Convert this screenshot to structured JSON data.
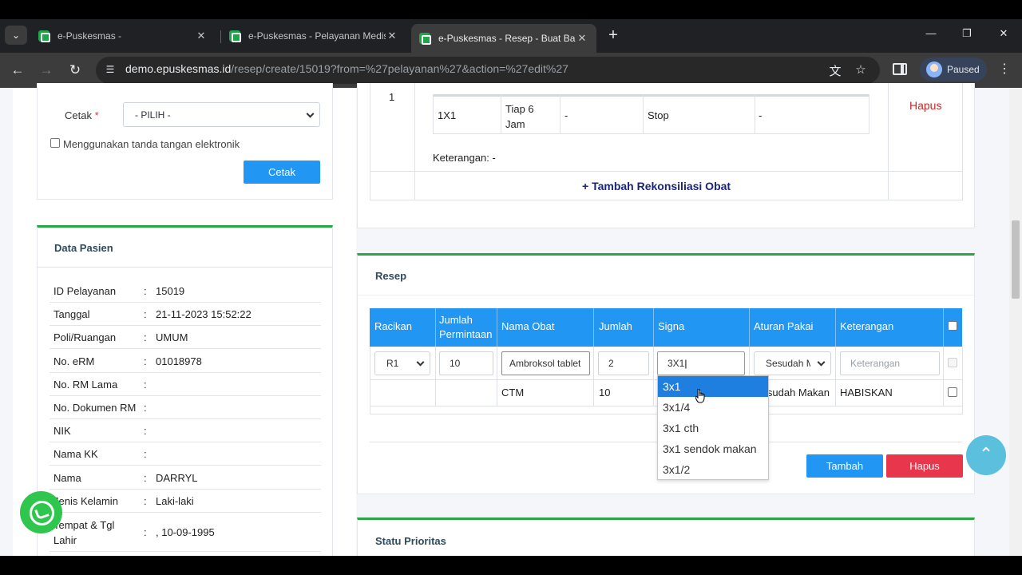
{
  "browser": {
    "tabs": [
      {
        "title": "e-Puskesmas -"
      },
      {
        "title": "e-Puskesmas - Pelayanan Medis"
      },
      {
        "title": "e-Puskesmas - Resep - Buat Baru"
      }
    ],
    "url_host": "demo.epuskesmas.id",
    "url_path": "/resep/create/15019?from=%27pelayanan%27&action=%27edit%27",
    "profile_label": "Paused"
  },
  "print_card": {
    "cetak_label": "Cetak",
    "required_mark": "*",
    "select_value": "- PILIH -",
    "esign_label": "Menggunakan tanda tangan elektronik",
    "cetak_button": "Cetak"
  },
  "patient": {
    "title": "Data Pasien",
    "rows": [
      {
        "key": "ID Pelayanan",
        "value": "15019"
      },
      {
        "key": "Tanggal",
        "value": "21-11-2023 15:52:22"
      },
      {
        "key": "Poli/Ruangan",
        "value": "UMUM"
      },
      {
        "key": "No. eRM",
        "value": "01018978"
      },
      {
        "key": "No. RM Lama",
        "value": ""
      },
      {
        "key": "No. Dokumen RM",
        "value": ""
      },
      {
        "key": "NIK",
        "value": ""
      },
      {
        "key": "Nama KK",
        "value": ""
      },
      {
        "key": "Nama",
        "value": "DARRYL"
      },
      {
        "key": "Jenis Kelamin",
        "value": "Laki-laki"
      },
      {
        "key": "Tempat & Tgl Lahir",
        "value": ", 10-09-1995"
      }
    ]
  },
  "reconciliation": {
    "row_no": "1",
    "cells": [
      "1X1",
      "Tiap 6 Jam",
      "-",
      "Stop",
      "-"
    ],
    "keterangan": "Keterangan: -",
    "hapus_link": "Hapus",
    "add_link": "+ Tambah Rekonsiliasi Obat"
  },
  "resep": {
    "title": "Resep",
    "headers": [
      "Racikan",
      "Jumlah Permintaan",
      "Nama Obat",
      "Jumlah",
      "Signa",
      "Aturan Pakai",
      "Keterangan"
    ],
    "input_row": {
      "racikan": "R1",
      "jumlah_permintaan": "10",
      "nama_obat": "Ambroksol tablet",
      "jumlah": "2",
      "signa": "3X1",
      "aturan_pakai": "Sesudah Makan",
      "keterangan_placeholder": "Keterangan"
    },
    "data_row": {
      "racikan": "",
      "jumlah_permintaan": "",
      "nama_obat": "CTM",
      "jumlah": "10",
      "aturan_pakai": "Sesudah Makan",
      "keterangan": "HABISKAN"
    },
    "signa_suggestions": [
      "3x1",
      "3x1/4",
      "3x1 cth",
      "3x1 sendok makan",
      "3x1/2"
    ],
    "tambah_button": "Tambah",
    "hapus_button": "Hapus"
  },
  "status_prioritas": {
    "title": "Statu Prioritas"
  }
}
